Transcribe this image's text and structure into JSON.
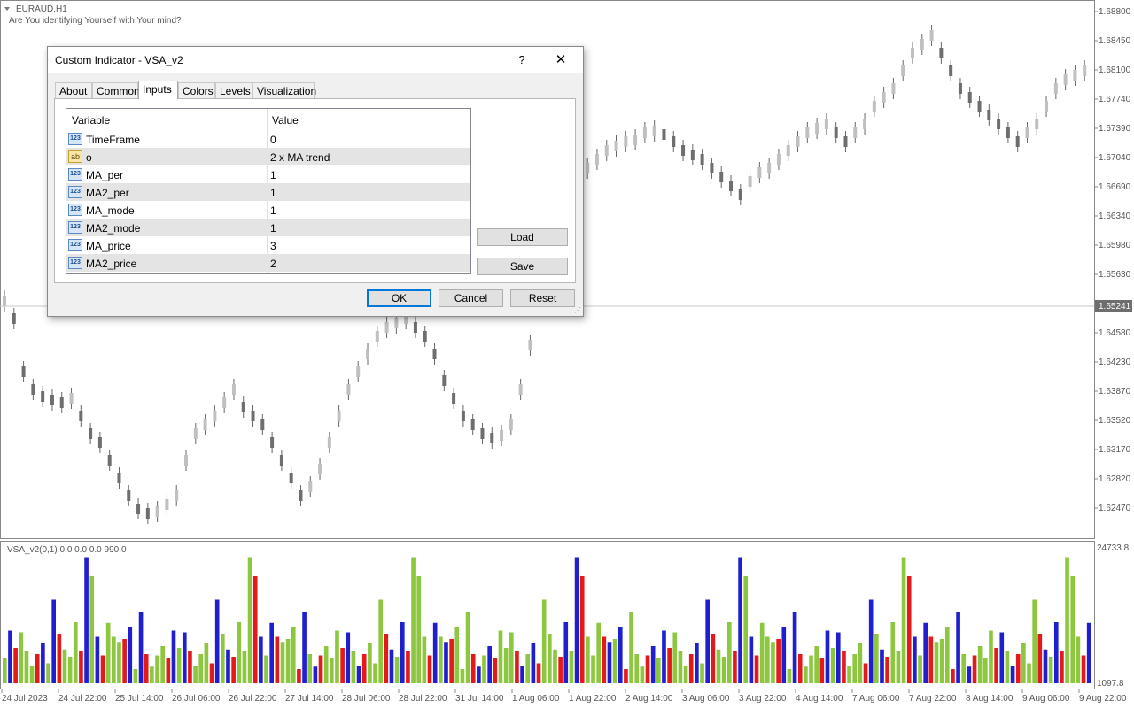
{
  "chart": {
    "symbol": "EURAUD,H1",
    "subtitle": "Are You identifying Yourself with Your mind?",
    "current_price": "1.65241",
    "price_ticks": [
      "1.68800",
      "1.68450",
      "1.68100",
      "1.67740",
      "1.67390",
      "1.67040",
      "1.66690",
      "1.66340",
      "1.65980",
      "1.65630",
      "1.65241",
      "1.64930",
      "1.64580",
      "1.64230",
      "1.63870",
      "1.63520",
      "1.63170",
      "1.62820",
      "1.62470"
    ],
    "indicator_label": "VSA_v2(0,1) 0.0 0.0 0.0 990.0",
    "indicator_top_value": "24733.8",
    "indicator_bottom_value": "0.0",
    "indicator_bottom_value2": "1097.8",
    "time_labels": [
      "24 Jul 2023",
      "24 Jul 22:00",
      "25 Jul 14:00",
      "26 Jul 06:00",
      "26 Jul 22:00",
      "27 Jul 14:00",
      "28 Jul 06:00",
      "28 Jul 22:00",
      "31 Jul 14:00",
      "1 Aug 06:00",
      "1 Aug 22:00",
      "2 Aug 14:00",
      "3 Aug 06:00",
      "3 Aug 22:00",
      "4 Aug 14:00",
      "7 Aug 06:00",
      "7 Aug 22:00",
      "8 Aug 14:00",
      "9 Aug 06:00",
      "9 Aug 22:00"
    ],
    "colors": {
      "up_bar": "#c0c0c0",
      "down_bar": "#6e6e6e",
      "vol_green": "#8dc63f",
      "vol_red": "#e31a1c",
      "vol_blue": "#1f1fcf",
      "axis": "#888888"
    }
  },
  "dialog": {
    "title": "Custom Indicator - VSA_v2",
    "help_label": "?",
    "close_label": "✕",
    "tabs": [
      "About",
      "Common",
      "Inputs",
      "Colors",
      "Levels",
      "Visualization"
    ],
    "active_tab": "Inputs",
    "columns": {
      "variable": "Variable",
      "value": "Value"
    },
    "rows": [
      {
        "icon": "123",
        "variable": "TimeFrame",
        "value": "0"
      },
      {
        "icon": "ab",
        "variable": "o",
        "value": "2 x MA trend"
      },
      {
        "icon": "123",
        "variable": "MA_per",
        "value": "1"
      },
      {
        "icon": "123",
        "variable": "MA2_per",
        "value": "1"
      },
      {
        "icon": "123",
        "variable": "MA_mode",
        "value": "1"
      },
      {
        "icon": "123",
        "variable": "MA2_mode",
        "value": "1"
      },
      {
        "icon": "123",
        "variable": "MA_price",
        "value": "3"
      },
      {
        "icon": "123",
        "variable": "MA2_price",
        "value": "2"
      }
    ],
    "buttons": {
      "load": "Load",
      "save": "Save",
      "ok": "OK",
      "cancel": "Cancel",
      "reset": "Reset"
    }
  }
}
